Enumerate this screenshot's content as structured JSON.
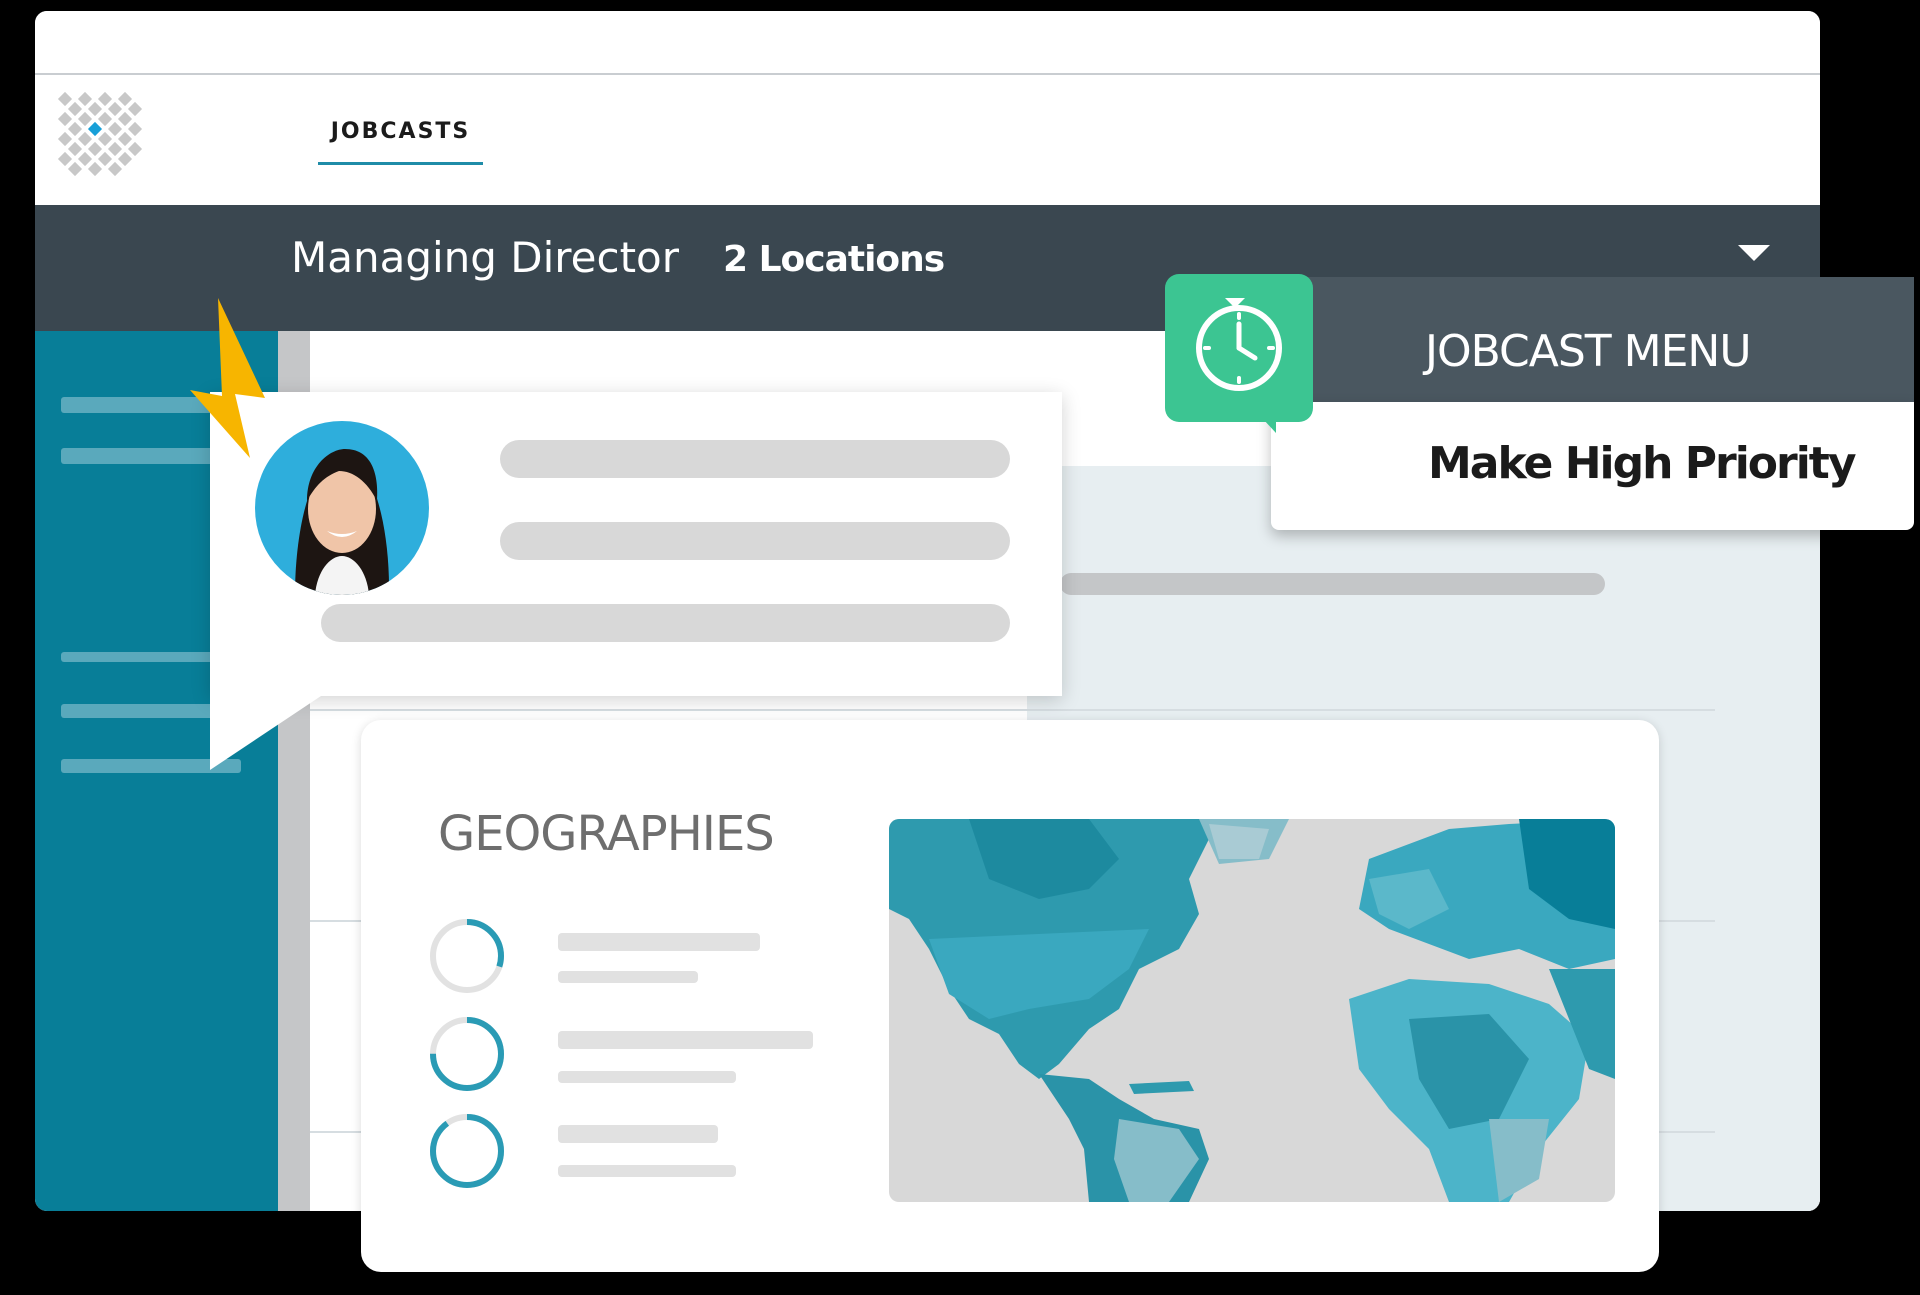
{
  "nav": {
    "tab_label": "JOBCASTS"
  },
  "job": {
    "title": "Managing Director",
    "locations": "2 Locations"
  },
  "menu": {
    "header": "JOBCAST MENU",
    "item": "Make High Priority"
  },
  "geographies": {
    "title": "GEOGRAPHIES",
    "progress": [
      0.3,
      0.75,
      0.9
    ]
  },
  "colors": {
    "accent": "#1f8ca8",
    "jobbar": "#3a4750",
    "sidebar": "#087e98",
    "clock_badge": "#3cc592",
    "bolt": "#f7b500",
    "avatar_bg": "#2eaedc"
  },
  "icons": {
    "logo": "diamond-grid-logo",
    "caret": "caret-down-icon",
    "clock": "clock-refresh-icon",
    "bolt": "lightning-bolt-icon"
  }
}
